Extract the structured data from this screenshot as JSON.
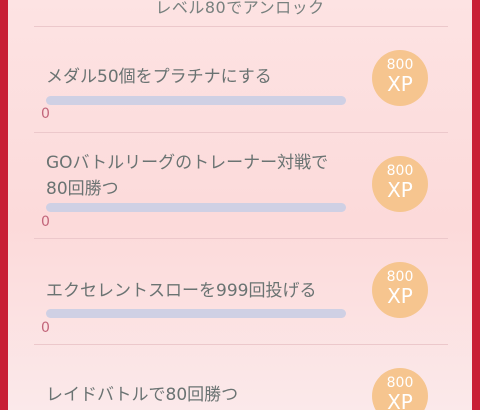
{
  "header": {
    "unlock_text": "レベル80でアンロック"
  },
  "tasks": [
    {
      "label": "メダル50個をプラチナにする",
      "progress": "0",
      "reward_amount": "800",
      "reward_unit": "XP"
    },
    {
      "label_line1": "GOバトルリーグのトレーナー対戦で",
      "label_line2": "80回勝つ",
      "progress": "0",
      "reward_amount": "800",
      "reward_unit": "XP"
    },
    {
      "label": "エクセレントスローを999回投げる",
      "progress": "0",
      "reward_amount": "800",
      "reward_unit": "XP"
    },
    {
      "label": "レイドバトルで80回勝つ",
      "reward_amount": "800",
      "reward_unit": "XP"
    }
  ],
  "colors": {
    "frame": "#c81f35",
    "panel": "#fde3e3",
    "xp_badge": "#f6c58f",
    "bar": "#cfd0e4",
    "progress_text": "#c2657a"
  }
}
